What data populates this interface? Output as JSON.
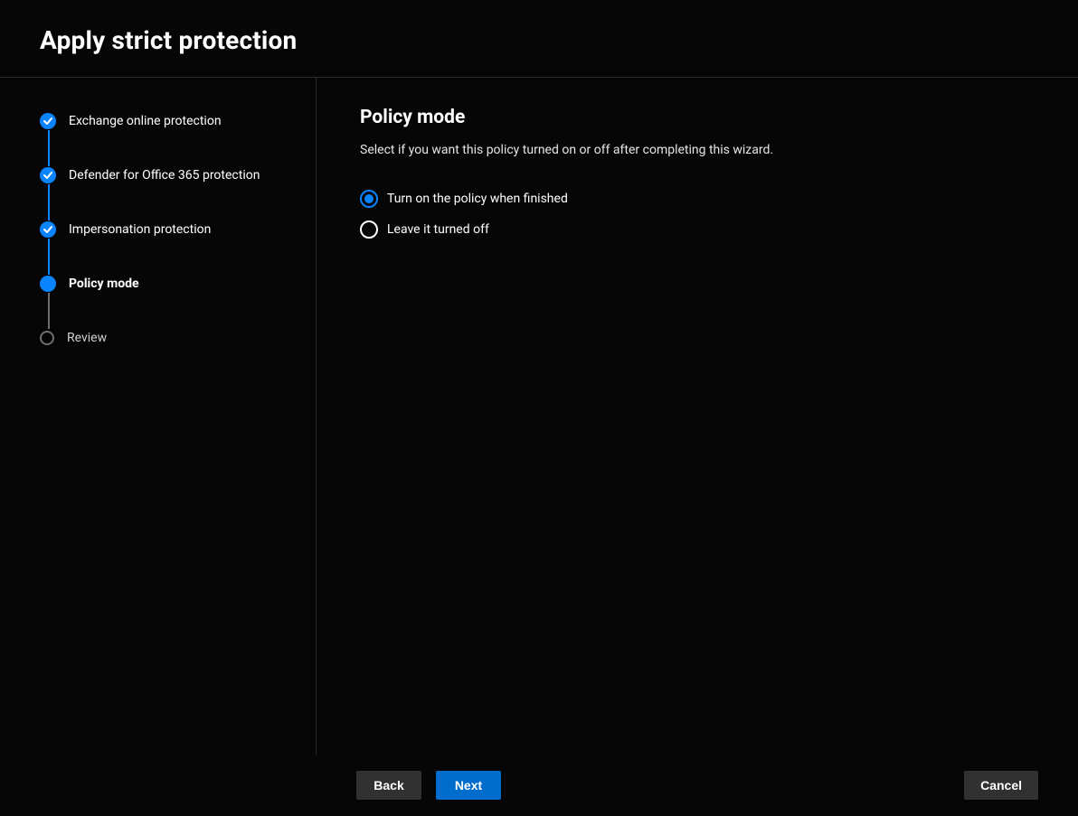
{
  "colors": {
    "accent": "#0a84ff",
    "button_primary": "#006dcc",
    "button_secondary": "#313131",
    "line_done": "#0a84ff",
    "line_pending": "#6e6e6e"
  },
  "header": {
    "title": "Apply strict protection"
  },
  "sidebar": {
    "steps": [
      {
        "label": "Exchange online protection",
        "state": "done"
      },
      {
        "label": "Defender for Office 365 protection",
        "state": "done"
      },
      {
        "label": "Impersonation protection",
        "state": "done"
      },
      {
        "label": "Policy mode",
        "state": "current"
      },
      {
        "label": "Review",
        "state": "pending"
      }
    ]
  },
  "content": {
    "heading": "Policy mode",
    "description": "Select if you want this policy turned on or off after completing this wizard.",
    "options": [
      {
        "label": "Turn on the policy when finished",
        "selected": true
      },
      {
        "label": "Leave it turned off",
        "selected": false
      }
    ]
  },
  "footer": {
    "back": "Back",
    "next": "Next",
    "cancel": "Cancel"
  }
}
